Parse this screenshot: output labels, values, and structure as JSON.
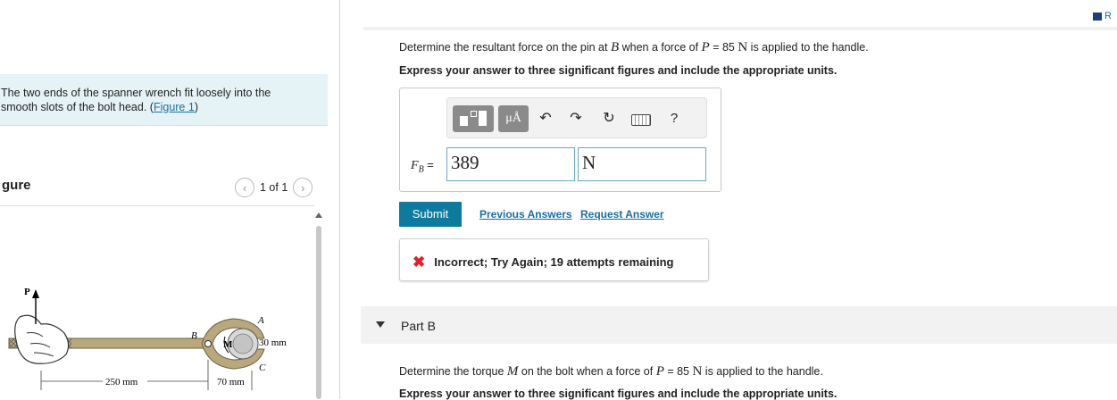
{
  "intro": {
    "text_line1": "The two ends of the spanner wrench fit loosely into the",
    "text_line2": "smooth slots of the bolt head. ",
    "figure_link": "Figure 1",
    "paren_open": "(",
    "paren_close": ")"
  },
  "figure_panel": {
    "title": "gure",
    "pager": "1 of 1",
    "prev_icon": "chevron-left-icon",
    "next_icon": "chevron-right-icon",
    "labels": {
      "P": "P",
      "A": "A",
      "B": "B",
      "C": "C",
      "M": "M",
      "radius": "30 mm",
      "dim1": "250 mm",
      "dim2": "70 mm"
    }
  },
  "corner": {
    "label": "R"
  },
  "part_a": {
    "question_pre": "Determine the resultant force on the pin at ",
    "question_var": "B",
    "question_mid": " when a force of ",
    "question_var2": "P",
    "question_eq": " = 85 ",
    "question_unit": "N",
    "question_post": " is applied to the handle.",
    "instruction": "Express your answer to three significant figures and include the appropriate units.",
    "toolbar": {
      "units_label": "μÅ",
      "undo_icon": "undo-icon",
      "redo_icon": "redo-icon",
      "reset_icon": "reset-icon",
      "keyboard_icon": "keyboard-icon",
      "help_label": "?"
    },
    "answer_label_var": "F",
    "answer_label_sub": "B",
    "answer_label_eq": " =",
    "value": "389",
    "unit": "N",
    "submit_label": "Submit",
    "previous_answers": "Previous Answers",
    "request_answer": "Request Answer",
    "feedback": "Incorrect; Try Again; 19 attempts remaining",
    "feedback_icon": "✖"
  },
  "part_b": {
    "label": "Part B",
    "question_pre": "Determine the torque ",
    "question_var": "M",
    "question_mid": " on the bolt when a force of ",
    "question_var2": "P",
    "question_eq": " = 85 ",
    "question_unit": "N",
    "question_post": " is applied to the handle.",
    "instruction": "Express your answer to three significant figures and include the appropriate units."
  },
  "colors": {
    "accent": "#0e7a9e",
    "link": "#1a6fa3",
    "error": "#d9232d",
    "intro_bg": "#e6f3f6"
  }
}
